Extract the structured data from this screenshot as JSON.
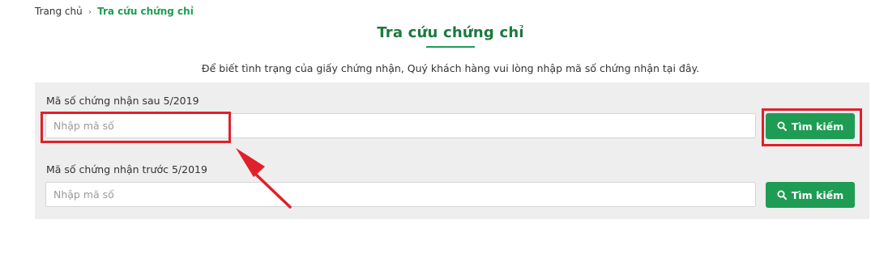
{
  "breadcrumb": {
    "home": "Trang chủ",
    "separator": "›",
    "current": "Tra cứu chứng chỉ"
  },
  "page": {
    "title": "Tra cứu chứng chỉ",
    "description": "Để biết tình trạng của giấy chứng nhận, Quý khách hàng vui lòng nhập mã số chứng nhận tại đây."
  },
  "search": {
    "after_2019": {
      "label": "Mã số chứng nhận sau 5/2019",
      "value": "",
      "placeholder": "Nhập mã số",
      "button_label": "Tìm kiếm",
      "button_icon": "search-icon"
    },
    "before_2019": {
      "label": "Mã số chứng nhận trước 5/2019",
      "value": "",
      "placeholder": "Nhập mã số",
      "button_label": "Tìm kiếm",
      "button_icon": "search-icon"
    }
  },
  "annotations": {
    "highlight_color": "#e0202a"
  },
  "colors": {
    "brand_green": "#1e9c54",
    "title_green": "#1a7a3e",
    "panel_background": "#eeeeee"
  }
}
